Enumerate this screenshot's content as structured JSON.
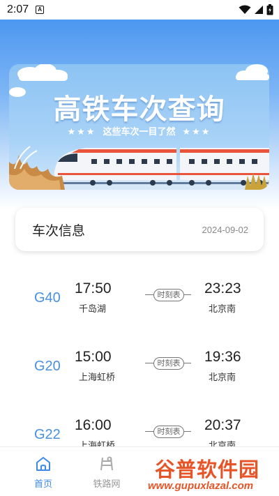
{
  "status_bar": {
    "time": "2:07",
    "notification_badge": "A"
  },
  "banner": {
    "title": "高铁车次查询",
    "subtitle": "这些车次一目了然",
    "stars_left": "★★★",
    "stars_right": "★★★"
  },
  "card": {
    "title": "车次信息",
    "date": "2024-09-02"
  },
  "trains": [
    {
      "code": "G40",
      "dep_time": "17:50",
      "dep_station": "千岛湖",
      "arr_time": "23:23",
      "arr_station": "北京南",
      "timetable_label": "时刻表"
    },
    {
      "code": "G20",
      "dep_time": "15:00",
      "dep_station": "上海虹桥",
      "arr_time": "19:36",
      "arr_station": "北京南",
      "timetable_label": "时刻表"
    },
    {
      "code": "G22",
      "dep_time": "16:00",
      "dep_station": "上海虹桥",
      "arr_time": "20:37",
      "arr_station": "北京南",
      "timetable_label": "时刻表"
    }
  ],
  "nav": [
    {
      "label": "首页",
      "icon": "home-icon",
      "active": true
    },
    {
      "label": "铁路网",
      "icon": "railway-icon",
      "active": false
    }
  ],
  "watermark": {
    "name": "谷普软件园",
    "url": "www.gupuxlazal.com"
  },
  "colors": {
    "accent": "#4a90e2",
    "sky": "#3f8ff0",
    "watermark": "#e65427"
  }
}
